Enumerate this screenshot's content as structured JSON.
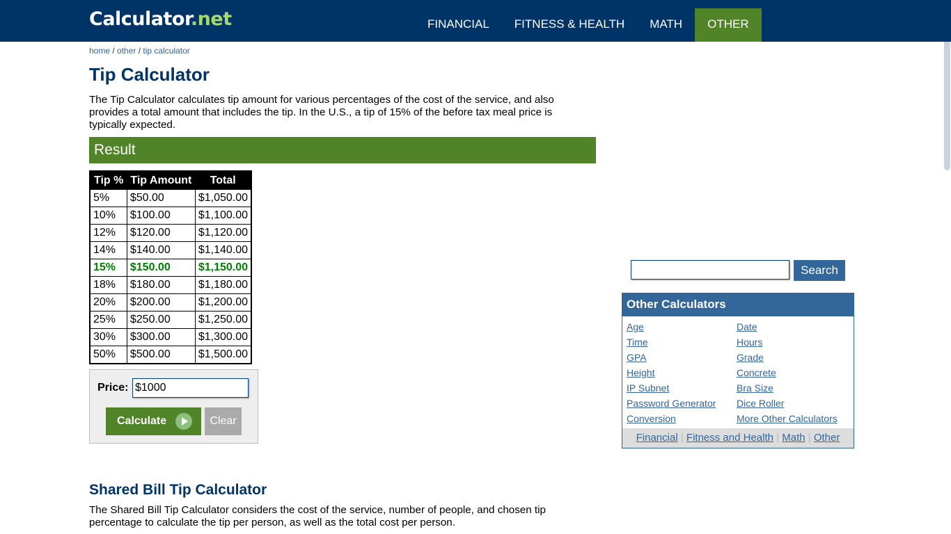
{
  "header": {
    "logo_main": "Calculator",
    "logo_tld": ".net",
    "nav": [
      {
        "label": "FINANCIAL",
        "active": false
      },
      {
        "label": "FITNESS & HEALTH",
        "active": false
      },
      {
        "label": "MATH",
        "active": false
      },
      {
        "label": "OTHER",
        "active": true
      }
    ]
  },
  "breadcrumb": {
    "items": [
      "home",
      "other",
      "tip calculator"
    ],
    "separator": " / "
  },
  "page": {
    "title": "Tip Calculator",
    "intro": "The Tip Calculator calculates tip amount for various percentages of the cost of the service, and also provides a total amount that includes the tip. In the U.S., a tip of 15% of the before tax meal price is typically expected.",
    "result_heading": "Result"
  },
  "tip_table": {
    "headers": [
      "Tip %",
      "Tip Amount",
      "Total"
    ],
    "highlight_color": "#008000",
    "rows": [
      {
        "pct": "5%",
        "tip": "$50.00",
        "total": "$1,050.00",
        "highlight": false
      },
      {
        "pct": "10%",
        "tip": "$100.00",
        "total": "$1,100.00",
        "highlight": false
      },
      {
        "pct": "12%",
        "tip": "$120.00",
        "total": "$1,120.00",
        "highlight": false
      },
      {
        "pct": "14%",
        "tip": "$140.00",
        "total": "$1,140.00",
        "highlight": false
      },
      {
        "pct": "15%",
        "tip": "$150.00",
        "total": "$1,150.00",
        "highlight": true
      },
      {
        "pct": "18%",
        "tip": "$180.00",
        "total": "$1,180.00",
        "highlight": false
      },
      {
        "pct": "20%",
        "tip": "$200.00",
        "total": "$1,200.00",
        "highlight": false
      },
      {
        "pct": "25%",
        "tip": "$250.00",
        "total": "$1,250.00",
        "highlight": false
      },
      {
        "pct": "30%",
        "tip": "$300.00",
        "total": "$1,300.00",
        "highlight": false
      },
      {
        "pct": "50%",
        "tip": "$500.00",
        "total": "$1,500.00",
        "highlight": false
      }
    ]
  },
  "form": {
    "price_label": "Price:",
    "price_value": "$1000",
    "calculate_label": "Calculate",
    "clear_label": "Clear"
  },
  "shared": {
    "title": "Shared Bill Tip Calculator",
    "description": "The Shared Bill Tip Calculator considers the cost of the service, number of people, and chosen tip percentage to calculate the tip per person, as well as the total cost per person."
  },
  "sidebar": {
    "search_value": "",
    "search_label": "Search",
    "other_title": "Other Calculators",
    "links_left": [
      "Age",
      "Time",
      "GPA",
      "Height",
      "IP Subnet",
      "Password Generator",
      "Conversion"
    ],
    "links_right": [
      "Date",
      "Hours",
      "Grade",
      "Concrete",
      "Bra Size",
      "Dice Roller",
      "More Other Calculators"
    ],
    "footer_links": [
      "Financial",
      "Fitness and Health",
      "Math",
      "Other"
    ],
    "footer_separator": "|"
  },
  "colors": {
    "header_bg": "#003366",
    "accent_green": "#518428",
    "link_blue": "#336699",
    "logo_tld": "#a5d96f"
  }
}
